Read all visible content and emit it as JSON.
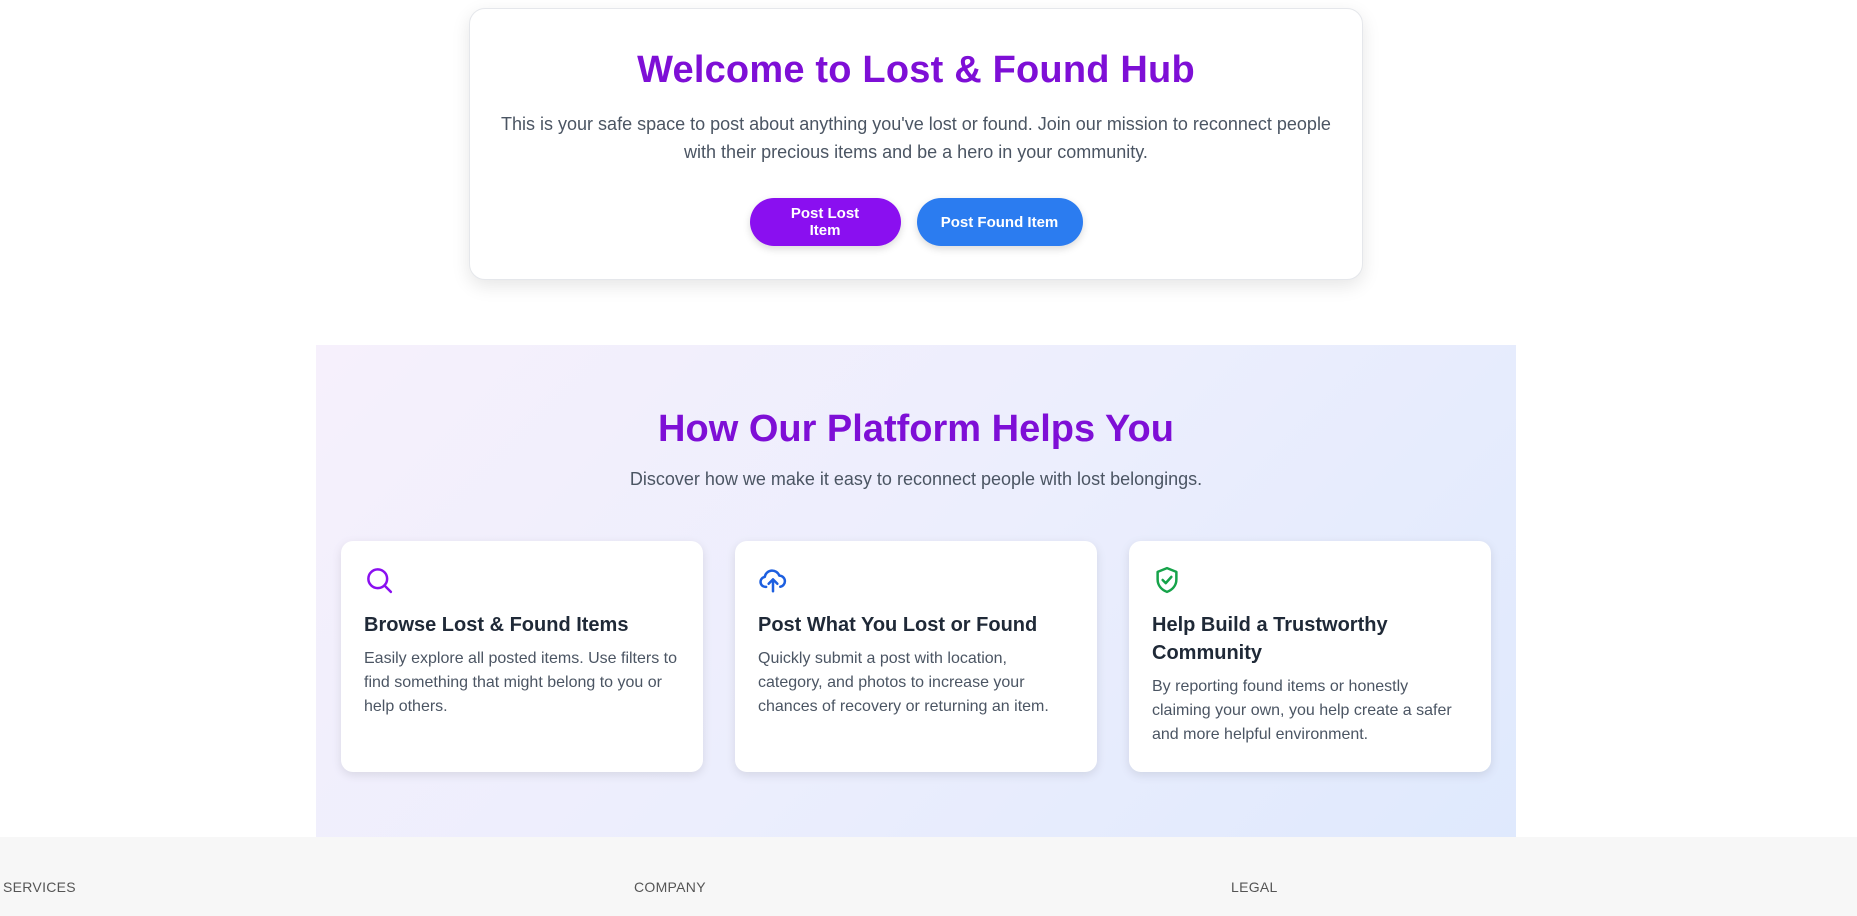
{
  "hero": {
    "title": "Welcome to Lost & Found Hub",
    "description": "This is your safe space to post about anything you've lost or found. Join our mission to reconnect people with their precious items and be a hero in your community.",
    "post_lost_label": "Post Lost Item",
    "post_found_label": "Post Found Item"
  },
  "features": {
    "title": "How Our Platform Helps You",
    "subtitle": "Discover how we make it easy to reconnect people with lost belongings.",
    "cards": [
      {
        "icon": "search-icon",
        "icon_color": "#8a0ff0",
        "title": "Browse Lost & Found Items",
        "text": "Easily explore all posted items. Use filters to find something that might belong to you or help others."
      },
      {
        "icon": "cloud-upload-icon",
        "icon_color": "#1d5fe0",
        "title": "Post What You Lost or Found",
        "text": "Quickly submit a post with location, category, and photos to increase your chances of recovery or returning an item."
      },
      {
        "icon": "shield-check-icon",
        "icon_color": "#16a34a",
        "title": "Help Build a Trustworthy Community",
        "text": "By reporting found items or honestly claiming your own, you help create a safer and more helpful environment."
      }
    ]
  },
  "footer": {
    "columns": [
      "SERVICES",
      "COMPANY",
      "LEGAL"
    ]
  },
  "colors": {
    "accent_purple": "#7e0fd6",
    "button_purple": "#8a0ff0",
    "button_blue": "#2b7cf0"
  }
}
